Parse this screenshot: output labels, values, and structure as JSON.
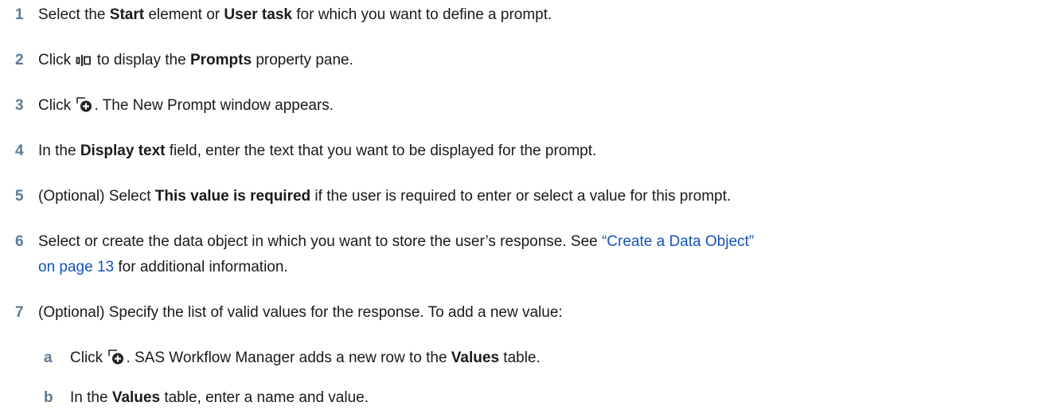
{
  "steps": [
    {
      "num": "1",
      "parts": [
        "Select the ",
        "Start",
        " element or ",
        "User task",
        " for which you want to define a prompt."
      ]
    },
    {
      "num": "2",
      "before": "Click ",
      "icon": "prompts-pane-icon",
      "after": " to display the ",
      "bold": "Prompts",
      "end": " property pane."
    },
    {
      "num": "3",
      "before": "Click ",
      "icon": "new-prompt-add-icon",
      "after": ". The New Prompt window appears."
    },
    {
      "num": "4",
      "before": "In the ",
      "bold": "Display text",
      "after": " field, enter the text that you want to be displayed for the prompt."
    },
    {
      "num": "5",
      "before": "(Optional) Select ",
      "bold": "This value is required",
      "after": " if the user is required to enter or select a value for this prompt."
    },
    {
      "num": "6",
      "before": "Select or create the data object in which you want to store the user’s response. See ",
      "link": "“Create a Data Object” on page 13",
      "after": " for additional information."
    },
    {
      "num": "7",
      "text": "(Optional) Specify the list of valid values for the response. To add a new value:"
    }
  ],
  "substeps": [
    {
      "num": "a",
      "before": "Click ",
      "icon": "add-row-icon",
      "middle": ". SAS Workflow Manager adds a new row to the ",
      "bold": "Values",
      "after": " table."
    },
    {
      "num": "b",
      "before": "In the ",
      "bold": "Values",
      "after": " table, enter a name and value."
    }
  ],
  "colors": {
    "step_number": "#5c7a95",
    "link": "#1654b5",
    "text": "#1a1a1a"
  }
}
